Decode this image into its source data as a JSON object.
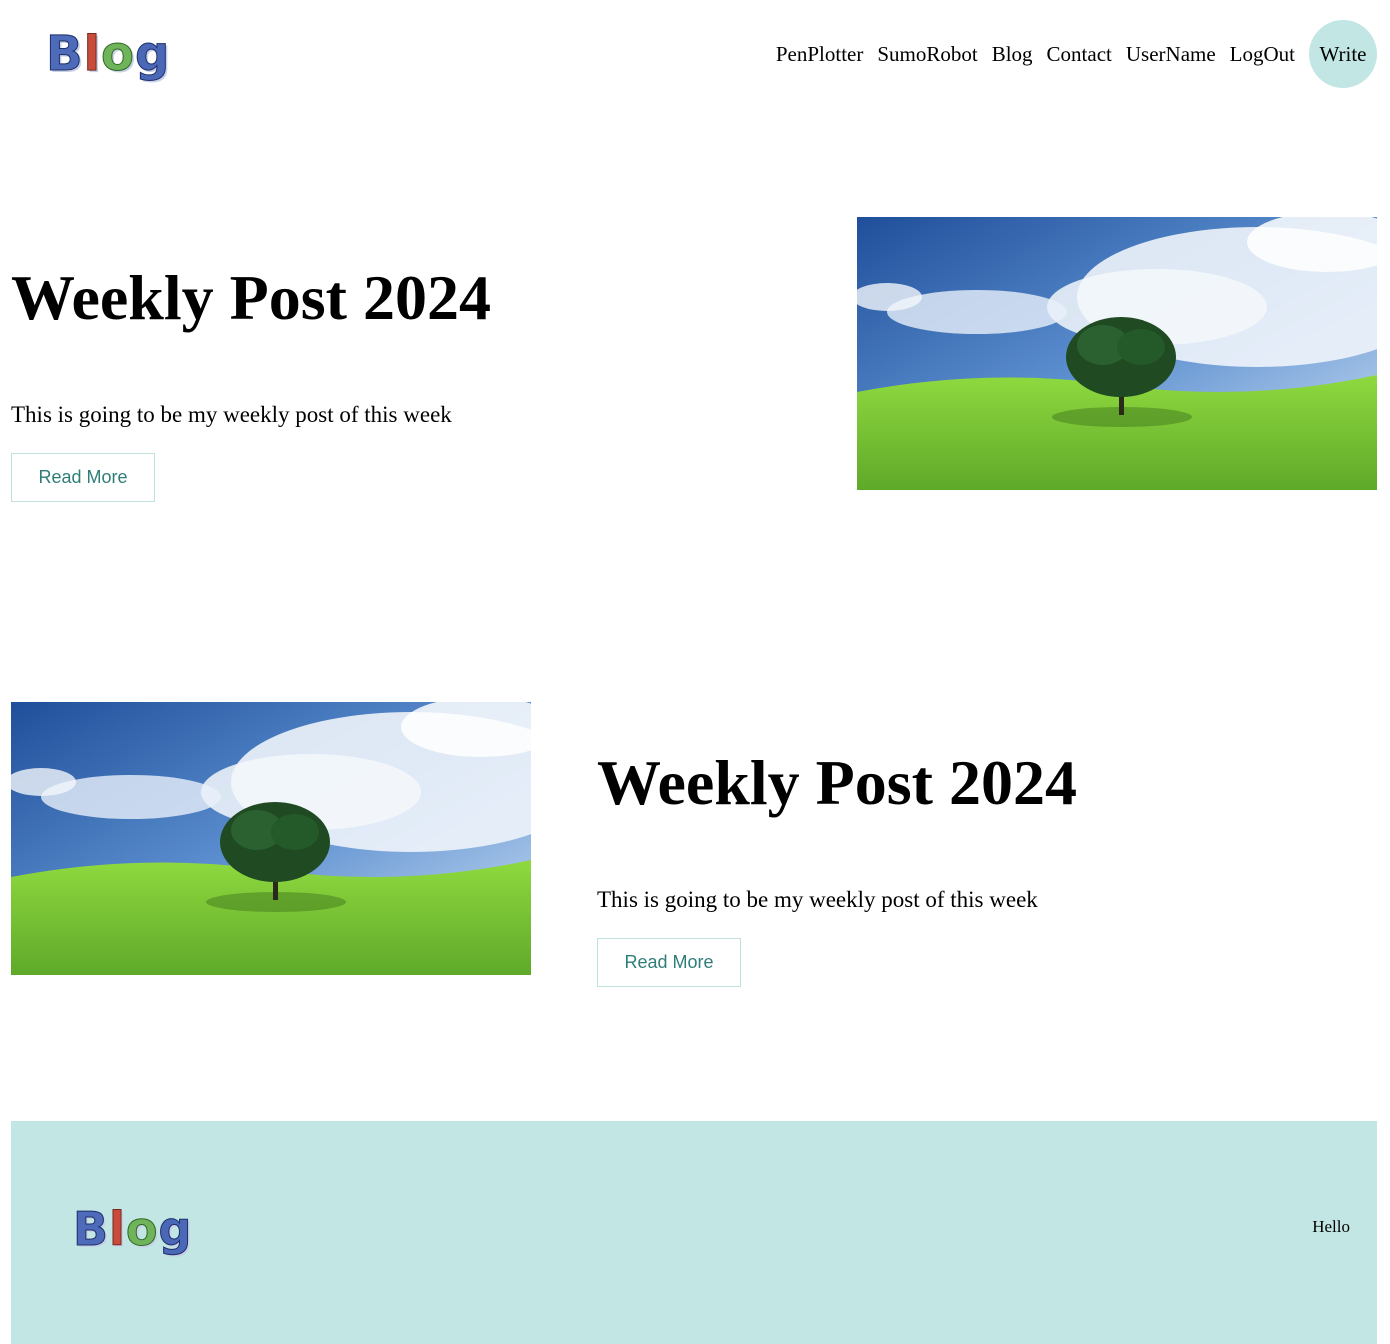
{
  "header": {
    "logo_text": "Blog",
    "nav": [
      "PenPlotter",
      "SumoRobot",
      "Blog",
      "Contact",
      "UserName",
      "LogOut"
    ],
    "write_label": "Write",
    "write_color": "#c2e6e4"
  },
  "posts": [
    {
      "title": "Weekly Post 2024",
      "text": "This is going to be my weekly post of this week",
      "button": "Read More"
    },
    {
      "title": "Weekly Post 2024",
      "text": "This is going to be my weekly post of this week",
      "button": "Read More"
    }
  ],
  "footer": {
    "logo_text": "Blog",
    "text": "Hello",
    "background": "#c2e6e4"
  },
  "colors": {
    "accent": "#c2e6e4",
    "button_text": "#2f7d78",
    "button_border": "#bfe2df"
  }
}
